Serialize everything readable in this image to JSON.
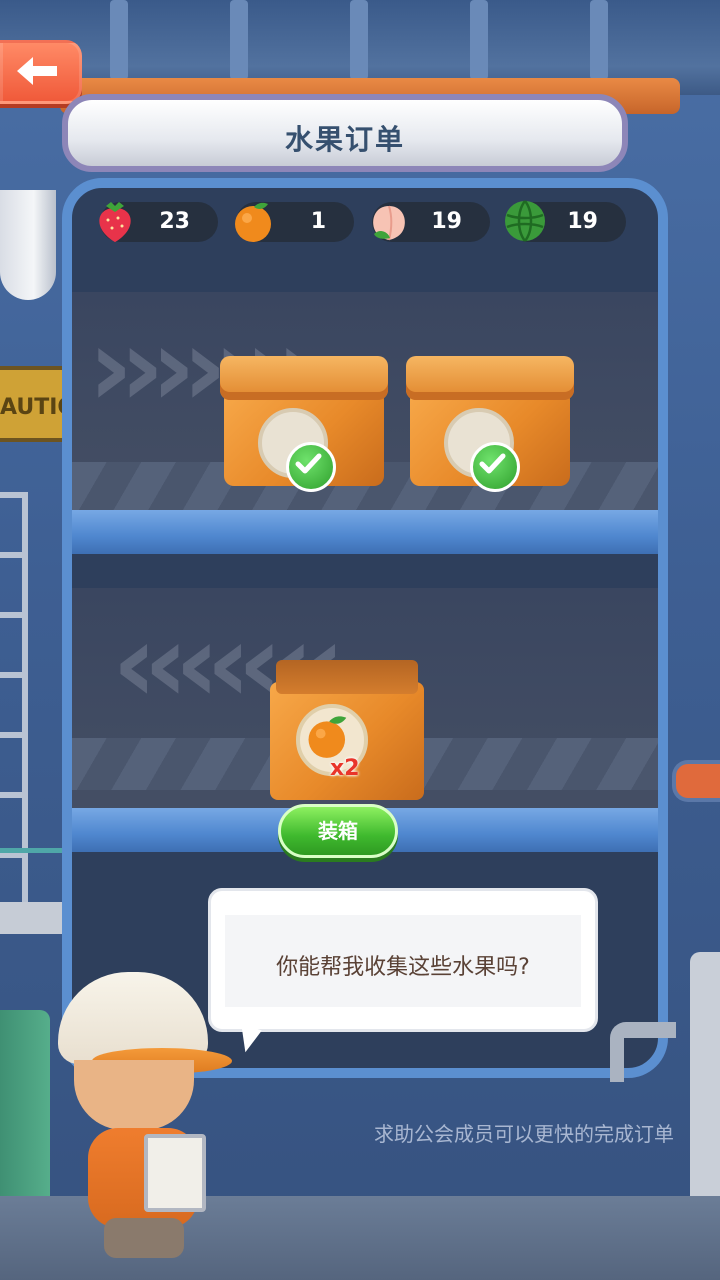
{
  "header": {
    "title": "水果订单",
    "back_icon": "arrow-left-icon"
  },
  "resources": [
    {
      "icon": "strawberry-icon",
      "count": "23",
      "color": "#e8334a"
    },
    {
      "icon": "orange-icon",
      "count": "1",
      "color": "#f08a1c"
    },
    {
      "icon": "peach-icon",
      "count": "19",
      "color": "#f7c3b4"
    },
    {
      "icon": "watermelon-icon",
      "count": "19",
      "color": "#3a9a3a"
    }
  ],
  "decor": {
    "caution_text": "AUTION"
  },
  "orders": {
    "completed_boxes": [
      {
        "status": "completed",
        "icon": "checkmark-icon"
      },
      {
        "status": "completed",
        "icon": "checkmark-icon"
      }
    ],
    "pending_box": {
      "fruit_icon": "orange-icon",
      "quantity": "x2"
    }
  },
  "actions": {
    "pack_label": "装箱"
  },
  "dialog": {
    "message": "你能帮我收集这些水果吗?"
  },
  "hint": {
    "text": "求助公会成员可以更快的完成订单"
  },
  "colors": {
    "accent_green": "#3fb92e",
    "back_button": "#f05a3a",
    "frame_blue": "#5b8fd0"
  }
}
